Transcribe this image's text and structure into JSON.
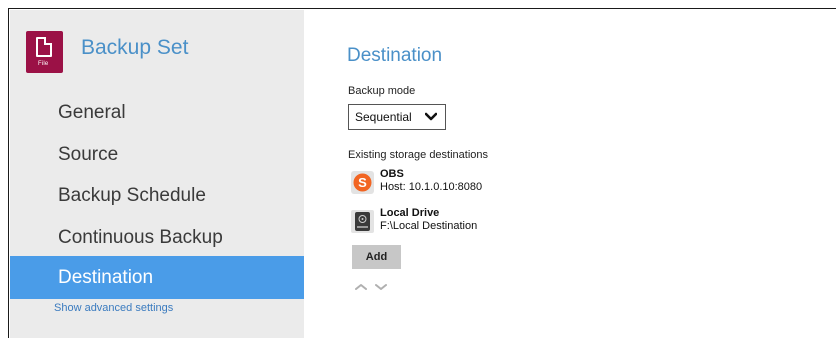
{
  "sidebar": {
    "set_icon_tag": "File",
    "title": "Backup Set",
    "items": [
      {
        "label": "General"
      },
      {
        "label": "Source"
      },
      {
        "label": "Backup Schedule"
      },
      {
        "label": "Continuous Backup"
      },
      {
        "label": "Destination",
        "active": true
      }
    ],
    "advanced_link": "Show advanced settings"
  },
  "main": {
    "title": "Destination",
    "backup_mode_label": "Backup mode",
    "backup_mode_value": "Sequential",
    "existing_label": "Existing storage destinations",
    "destinations": [
      {
        "name": "OBS",
        "detail": "Host: 10.1.0.10:8080",
        "icon": "obs-logo-icon"
      },
      {
        "name": "Local Drive",
        "detail": "F:\\Local Destination",
        "icon": "local-drive-icon"
      }
    ],
    "add_label": "Add"
  },
  "colors": {
    "accent": "#4a9ce8",
    "title_blue": "#4a90c8",
    "icon_magenta": "#9b1146",
    "obs_orange": "#f26522",
    "sidebar_bg": "#ebebeb"
  }
}
